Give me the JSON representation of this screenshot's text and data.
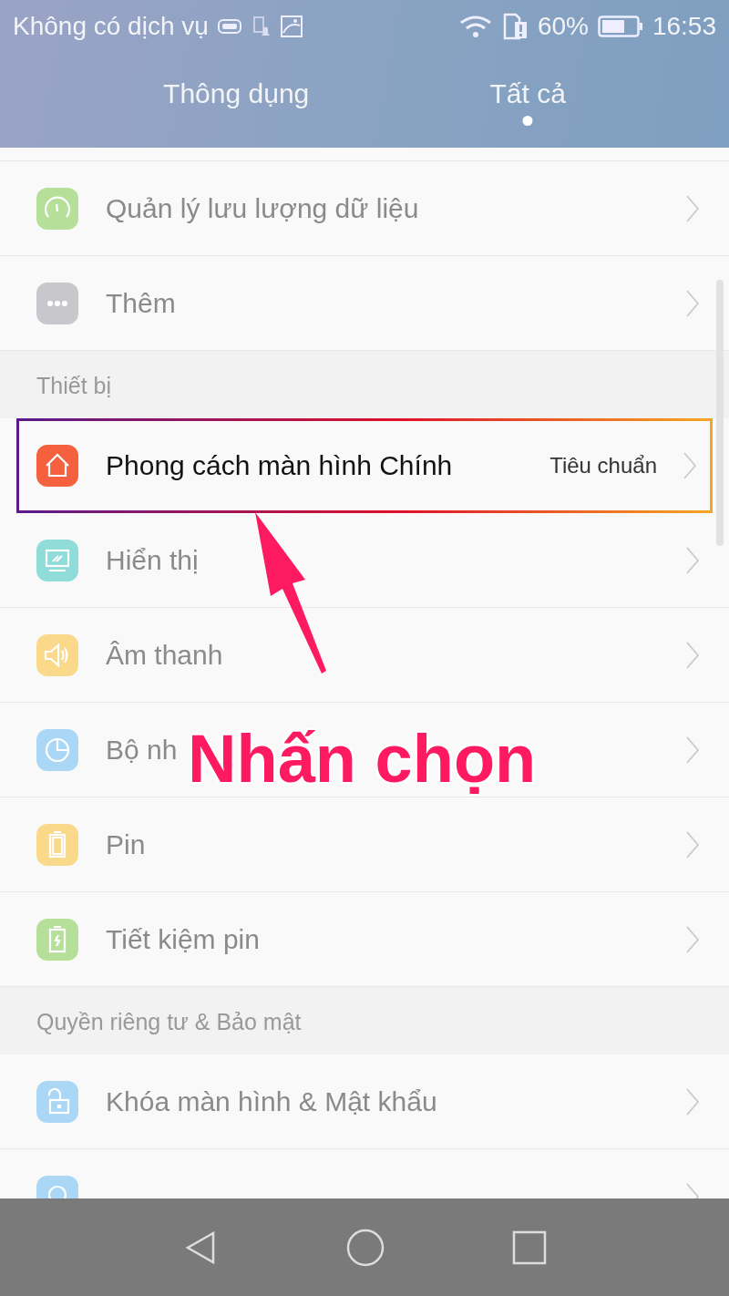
{
  "status_bar": {
    "carrier": "Không có dịch vụ",
    "battery": "60%",
    "time": "16:53"
  },
  "tabs": [
    {
      "label": "Thông dụng",
      "selected": false
    },
    {
      "label": "Tất cả",
      "selected": true
    }
  ],
  "rows": [
    {
      "kind": "item",
      "label": "Quản lý lưu lượng dữ liệu",
      "color": "#b6e09a",
      "highlighted": false
    },
    {
      "kind": "item",
      "label": "Thêm",
      "color": "#c8c8cc",
      "highlighted": false
    },
    {
      "kind": "section",
      "label": "Thiết bị"
    },
    {
      "kind": "item",
      "label": "Phong cách màn hình Chính",
      "value": "Tiêu chuẩn",
      "color": "#f5603f",
      "highlighted": true
    },
    {
      "kind": "item",
      "label": "Hiển thị",
      "color": "#8fdcd8",
      "highlighted": false
    },
    {
      "kind": "item",
      "label": "Âm thanh",
      "color": "#fbd98b",
      "highlighted": false
    },
    {
      "kind": "item",
      "label": "Bộ nh",
      "color": "#a9d7f5",
      "highlighted": false
    },
    {
      "kind": "item",
      "label": "Pin",
      "color": "#fbd98b",
      "highlighted": false
    },
    {
      "kind": "item",
      "label": "Tiết kiệm pin",
      "color": "#b6e09a",
      "highlighted": false
    },
    {
      "kind": "section",
      "label": "Quyền riêng tư & Bảo mật"
    },
    {
      "kind": "item",
      "label": "Khóa màn hình & Mật khẩu",
      "color": "#a9d7f5",
      "highlighted": false
    },
    {
      "kind": "item",
      "color": "#a9d7f5",
      "highlighted": false
    }
  ],
  "annotation": {
    "text": "Nhấn chọn"
  }
}
